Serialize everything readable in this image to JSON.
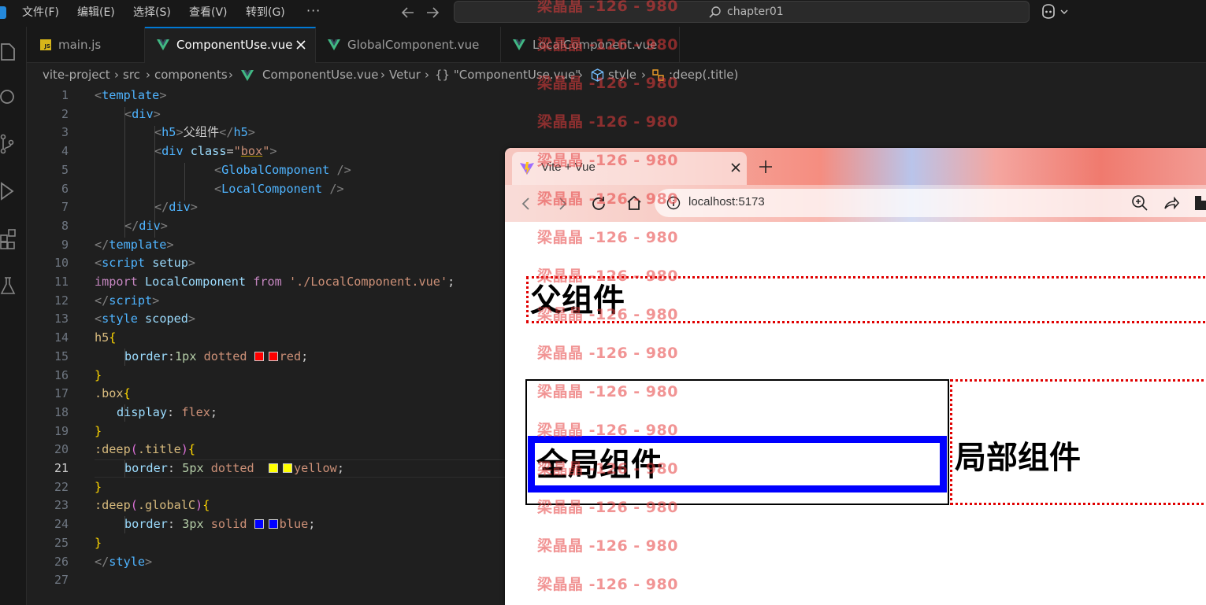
{
  "menu": {
    "items": [
      "文件(F)",
      "编辑(E)",
      "选择(S)",
      "查看(V)",
      "转到(G)"
    ],
    "more": "···"
  },
  "command_center": {
    "text": "chapter01"
  },
  "tabs": [
    {
      "label": "main.js",
      "icon": "js-icon"
    },
    {
      "label": "ComponentUse.vue",
      "icon": "vue-icon",
      "active": true
    },
    {
      "label": "GlobalComponent.vue",
      "icon": "vue-icon"
    },
    {
      "label": "LocalComponent.vue",
      "icon": "vue-icon"
    }
  ],
  "breadcrumb": {
    "items": [
      "vite-project",
      "src",
      "components",
      "ComponentUse.vue",
      "Vetur",
      "{} \"ComponentUse.vue\"",
      "style",
      ":deep(.title)"
    ]
  },
  "editor": {
    "line_numbers": [
      "1",
      "2",
      "3",
      "4",
      "5",
      "6",
      "7",
      "8",
      "9",
      "10",
      "11",
      "12",
      "13",
      "14",
      "15",
      "16",
      "17",
      "18",
      "19",
      "20",
      "21",
      "22",
      "23",
      "24",
      "25",
      "26",
      "27"
    ],
    "current_line": 21,
    "code": {
      "l1": {
        "open": "<",
        "tag": "template",
        "close": ">"
      },
      "l2": {
        "open": "<",
        "tag": "div",
        "close": ">"
      },
      "l3": {
        "open": "<",
        "tag": "h5",
        "mid": ">",
        "text": "父组件",
        "end_open": "</",
        "end_tag": "h5",
        "close": ">"
      },
      "l4": {
        "open": "<",
        "tag": "div",
        "attr": "class",
        "eq": "=",
        "q1": "\"",
        "val": "box",
        "q2": "\"",
        "close": ">"
      },
      "l5": {
        "open": "<",
        "tag": "GlobalComponent",
        "close": " />"
      },
      "l6": {
        "open": "<",
        "tag": "LocalComponent",
        "close": " />"
      },
      "l7": {
        "open": "</",
        "tag": "div",
        "close": ">"
      },
      "l8": {
        "open": "</",
        "tag": "div",
        "close": ">"
      },
      "l9": {
        "open": "</",
        "tag": "template",
        "close": ">"
      },
      "l10": {
        "open": "<",
        "tag": "script",
        "attr": "setup",
        "close": ">"
      },
      "l11": {
        "kw1": "import",
        "name": "LocalComponent",
        "kw2": "from",
        "str": "'./LocalComponent.vue'",
        "semi": ";"
      },
      "l12": {
        "open": "</",
        "tag": "script",
        "close": ">"
      },
      "l13": {
        "open": "<",
        "tag": "style",
        "attr": "scoped",
        "close": ">"
      },
      "l14": {
        "sel": "h5",
        "brace": "{"
      },
      "l15": {
        "prop": "border",
        "colon": ":",
        "num": "1px",
        "kw": "dotted",
        "color": "red",
        "semi": ";"
      },
      "l16": {
        "brace": "}"
      },
      "l17": {
        "sel": ".box",
        "brace": "{"
      },
      "l18": {
        "prop": "display",
        "colon": ":",
        "val": "flex",
        "semi": ";"
      },
      "l19": {
        "brace": "}"
      },
      "l20": {
        "sel1": ":deep",
        "paren1": "(",
        "sel2": ".title",
        "paren2": ")",
        "brace": "{"
      },
      "l21": {
        "prop": "border",
        "colon": ":",
        "num": "5px",
        "kw": "dotted",
        "color": "yellow",
        "semi": ";"
      },
      "l22": {
        "brace": "}"
      },
      "l23": {
        "sel1": ":deep",
        "paren1": "(",
        "sel2": ".globalC",
        "paren2": ")",
        "brace": "{"
      },
      "l24": {
        "prop": "border",
        "colon": ":",
        "num": "3px",
        "kw": "solid",
        "color": "blue",
        "semi": ";"
      },
      "l25": {
        "brace": "}"
      },
      "l26": {
        "open": "</",
        "tag": "style",
        "close": ">"
      }
    },
    "swatch_colors": {
      "red": "#ff0000",
      "yellow": "#ffff00",
      "blue": "#0000ff"
    }
  },
  "browser": {
    "tab_title": "Vite + Vue",
    "address": "localhost:5173",
    "page": {
      "parent_heading": "父组件",
      "global_title": "全局组件",
      "local_title": "局部组件"
    }
  },
  "watermark": {
    "text": "梁晶晶 -126 - 980",
    "repeat": 16
  },
  "colors": {
    "accent": "#0078d4",
    "vue_green": "#41b883",
    "js_yellow": "#d7b51a",
    "h5_border": "#e00000",
    "global_border": "#0000ff"
  }
}
